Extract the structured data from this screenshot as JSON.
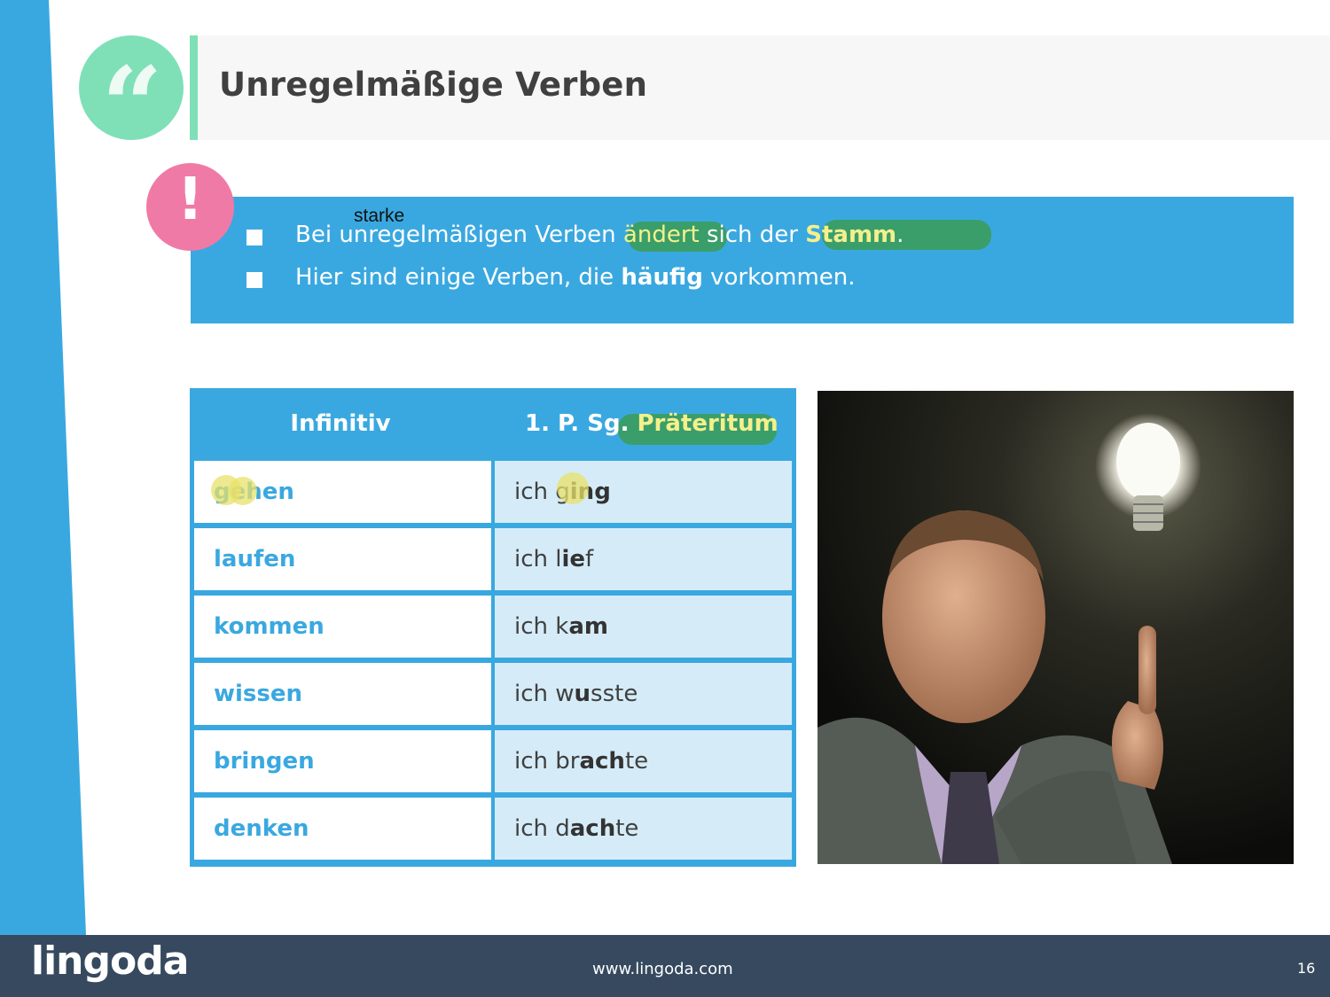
{
  "slide": {
    "title": "Unregelmäßige Verben",
    "quote_icon": "quote-icon",
    "alert_icon": "exclamation-icon",
    "colors": {
      "blue": "#3aa8e0",
      "mint": "#7fe0b8",
      "pink": "#f07aa6",
      "footer": "#36495f",
      "highlight_green": "#3a9e6a",
      "highlight_yellow": "#f4f08c"
    }
  },
  "info": {
    "annotation": "starke",
    "line1": {
      "pre": "Bei unregelmäßigen Verben ",
      "hl1": "ändert",
      "mid": " sich der ",
      "hl2": "Stamm",
      "post": "."
    },
    "line2": {
      "pre": "Hier sind einige Verben, die ",
      "bold": "häufig",
      "post": " vorkommen."
    }
  },
  "table": {
    "headers": {
      "col1": "Infinitiv",
      "col2_pre": "1. P. Sg. ",
      "col2_hl": "Präteritum"
    },
    "rows": [
      {
        "inf": "gehen",
        "pre": "ich g",
        "bold": "ing",
        "post": ""
      },
      {
        "inf": "laufen",
        "pre": "ich l",
        "bold": "ie",
        "post": "f"
      },
      {
        "inf": "kommen",
        "pre": "ich k",
        "bold": "am",
        "post": ""
      },
      {
        "inf": "wissen",
        "pre": "ich w",
        "bold": "u",
        "post": "sste"
      },
      {
        "inf": "bringen",
        "pre": "ich br",
        "bold": "ach",
        "post": "te"
      },
      {
        "inf": "denken",
        "pre": "ich d",
        "bold": "ach",
        "post": "te"
      }
    ]
  },
  "photo": {
    "icon": "lightbulb-man-photo"
  },
  "footer": {
    "logo": "lingoda",
    "url": "www.lingoda.com",
    "page": "16"
  }
}
